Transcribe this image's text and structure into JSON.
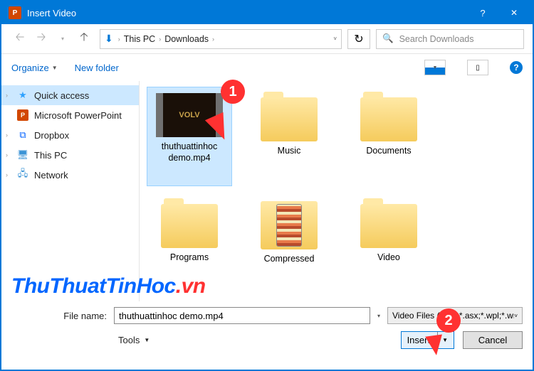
{
  "titlebar": {
    "title": "Insert Video"
  },
  "nav": {
    "crumbs": {
      "root": "This PC",
      "folder": "Downloads"
    },
    "search_placeholder": "Search Downloads"
  },
  "toolbar": {
    "organize": "Organize",
    "new_folder": "New folder"
  },
  "sidebar": {
    "items": [
      {
        "label": "Quick access"
      },
      {
        "label": "Microsoft PowerPoint"
      },
      {
        "label": "Dropbox"
      },
      {
        "label": "This PC"
      },
      {
        "label": "Network"
      }
    ]
  },
  "files": {
    "items": [
      {
        "label": "thuthuattinhoc demo.mp4"
      },
      {
        "label": "Music"
      },
      {
        "label": "Documents"
      },
      {
        "label": "Programs"
      },
      {
        "label": "Compressed"
      },
      {
        "label": "Video"
      }
    ]
  },
  "footer": {
    "filename_label": "File name:",
    "filename_value": "thuthuattinhoc demo.mp4",
    "filetype": "Video Files (*.asf;*.asx;*.wpl;*.wr",
    "tools": "Tools",
    "insert": "Insert",
    "cancel": "Cancel"
  },
  "annotations": {
    "badge1": "1",
    "badge2": "2"
  },
  "watermark": {
    "a": "ThuThuatTinHoc",
    "b": ".vn"
  }
}
